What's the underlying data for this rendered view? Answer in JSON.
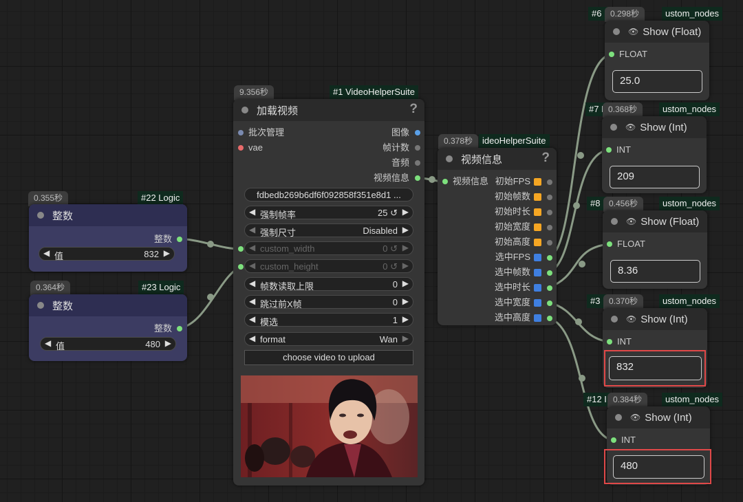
{
  "colors": {
    "link": "#8a9a86",
    "slot_green": "#7de07d",
    "slot_blue": "#5aa0e8",
    "slot_orange": "#f5a623",
    "slot_square_blue": "#3f7fe0",
    "highlight": "#e04848"
  },
  "node_logic_22": {
    "time": "0.355秒",
    "badge": "#22 Logic",
    "title": "整数",
    "output": "整数",
    "widget_label": "值",
    "widget_value": "832"
  },
  "node_logic_23": {
    "time": "0.364秒",
    "badge": "#23 Logic",
    "title": "整数",
    "output": "整数",
    "widget_label": "值",
    "widget_value": "480"
  },
  "node_vhs_load": {
    "time": "9.356秒",
    "badge": "#1 VideoHelperSuite",
    "title": "加载视频",
    "help": "?",
    "inputs": [
      "批次管理",
      "vae"
    ],
    "outputs": [
      "图像",
      "帧计数",
      "音频",
      "视频信息"
    ],
    "video_field": "fdbedb269b6df6f092858f351e8d1 ...",
    "widgets": [
      {
        "label": "强制帧率",
        "value": "25 ↺"
      },
      {
        "label": "强制尺寸",
        "value": "Disabled"
      },
      {
        "label": "custom_width",
        "value": "0 ↺"
      },
      {
        "label": "custom_height",
        "value": "0 ↺"
      },
      {
        "label": "帧数读取上限",
        "value": "0"
      },
      {
        "label": "跳过前X帧",
        "value": "0"
      },
      {
        "label": "模选",
        "value": "1"
      },
      {
        "label": "format",
        "value": "Wan"
      }
    ],
    "upload_button": "choose video to upload"
  },
  "node_vhs_info": {
    "time": "0.378秒",
    "badge": "ideoHelperSuite",
    "title": "视频信息",
    "help": "?",
    "input": "视频信息",
    "outputs": [
      "初始FPS",
      "初始帧数",
      "初始时长",
      "初始宽度",
      "初始高度",
      "选中FPS",
      "选中帧数",
      "选中时长",
      "选中宽度",
      "选中高度"
    ]
  },
  "show_nodes": [
    {
      "id": "#6 I",
      "time": "0.298秒",
      "suffix": "ustom_nodes",
      "title": "Show (Float)",
      "type": "FLOAT",
      "value": "25.0"
    },
    {
      "id": "#7 I",
      "time": "0.368秒",
      "suffix": "ustom_nodes",
      "title": "Show (Int)",
      "type": "INT",
      "value": "209"
    },
    {
      "id": "#8 I",
      "time": "0.456秒",
      "suffix": "ustom_nodes",
      "title": "Show (Float)",
      "type": "FLOAT",
      "value": "8.36"
    },
    {
      "id": "#3 I",
      "time": "0.370秒",
      "suffix": "ustom_nodes",
      "title": "Show (Int)",
      "type": "INT",
      "value": "832"
    },
    {
      "id": "#12 I",
      "time": "0.384秒",
      "suffix": "ustom_nodes",
      "title": "Show (Int)",
      "type": "INT",
      "value": "480"
    }
  ]
}
